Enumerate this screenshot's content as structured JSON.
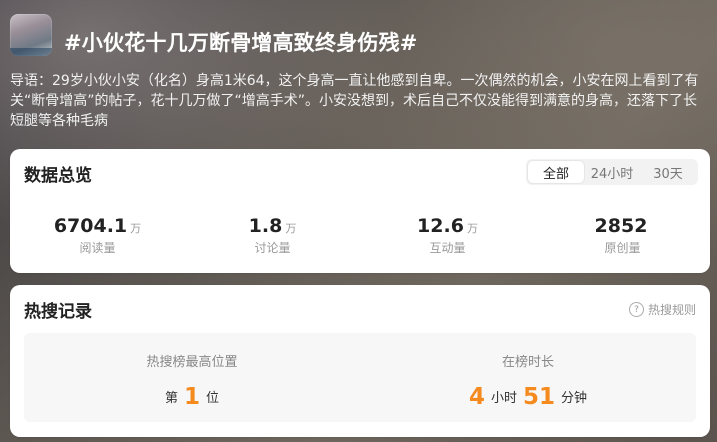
{
  "header": {
    "title": "#小伙花十几万断骨增高致终身伤残#",
    "intro": "导语：29岁小伙小安（化名）身高1米64，这个身高一直让他感到自卑。一次偶然的机会，小安在网上看到了有关“断骨增高”的帖子，花十几万做了“增高手术”。小安没想到，术后自己不仅没能得到满意的身高，还落下了长短腿等各种毛病"
  },
  "overview": {
    "title": "数据总览",
    "tabs": [
      "全部",
      "24小时",
      "30天"
    ],
    "active_tab": "全部",
    "stats": [
      {
        "value": "6704.1",
        "unit": "万",
        "label": "阅读量"
      },
      {
        "value": "1.8",
        "unit": "万",
        "label": "讨论量"
      },
      {
        "value": "12.6",
        "unit": "万",
        "label": "互动量"
      },
      {
        "value": "2852",
        "unit": "",
        "label": "原创量"
      }
    ]
  },
  "hot": {
    "title": "热搜记录",
    "rules_label": "热搜规则",
    "peak_label": "热搜榜最高位置",
    "peak_prefix": "第",
    "peak_value": "1",
    "peak_suffix": "位",
    "duration_label": "在榜时长",
    "hours": "4",
    "hours_unit": "小时",
    "minutes": "51",
    "minutes_unit": "分钟"
  },
  "colors": {
    "accent": "#f58a1f"
  },
  "icons": {
    "help": "help-circle-icon"
  }
}
